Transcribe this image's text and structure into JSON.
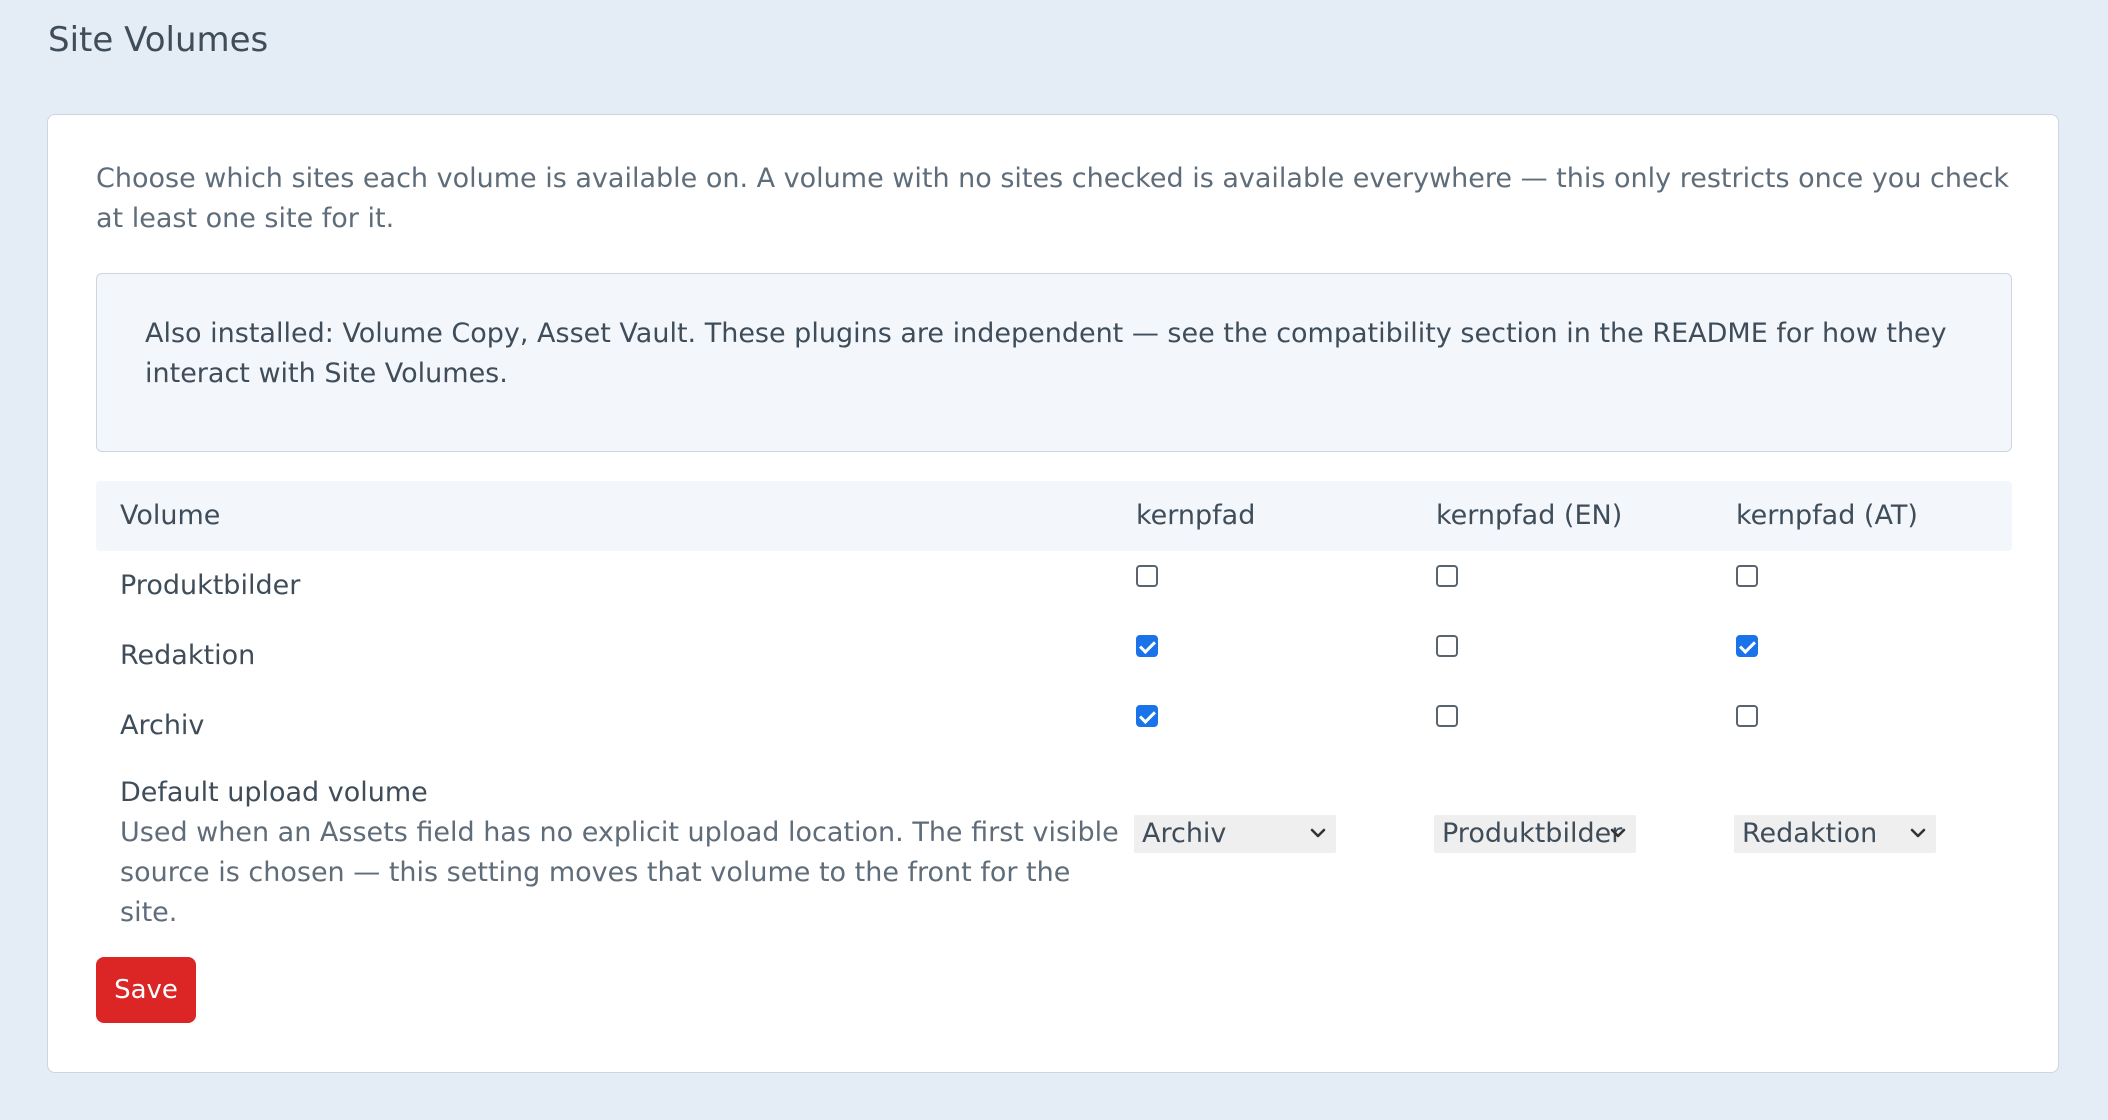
{
  "page": {
    "title": "Site Volumes"
  },
  "card": {
    "intro": "Choose which sites each volume is available on. A volume with no sites checked is available everywhere — this only restricts once you check at least one site for it.",
    "notice": "Also installed: Volume Copy, Asset Vault. These plugins are independent — see the compatibility section in the README for how they interact with Site Volumes."
  },
  "table": {
    "headers": [
      "Volume",
      "kernpfad",
      "kernpfad (EN)",
      "kernpfad (AT)"
    ],
    "rows": [
      {
        "label": "Produktbilder",
        "checked": [
          false,
          false,
          false
        ]
      },
      {
        "label": "Redaktion",
        "checked": [
          true,
          false,
          true
        ]
      },
      {
        "label": "Archiv",
        "checked": [
          true,
          false,
          false
        ]
      }
    ],
    "default_upload": {
      "label": "Default upload volume",
      "description": "Used when an Assets field has no explicit upload location. The first visible source is chosen — this setting moves that volume to the front for the site.",
      "selected": [
        "Archiv",
        "Produktbilder",
        "Redaktion"
      ]
    }
  },
  "actions": {
    "save_label": "Save"
  },
  "colors": {
    "background": "#e4ecf5",
    "card": "#ffffff",
    "accent": "#1a73e8",
    "save": "#dc2626"
  }
}
